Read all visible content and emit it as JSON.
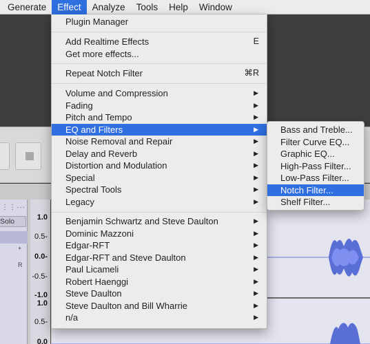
{
  "menubar": {
    "items": [
      "Generate",
      "Effect",
      "Analyze",
      "Tools",
      "Help",
      "Window"
    ],
    "active": "Effect"
  },
  "effect_menu": {
    "plugin_manager": "Plugin Manager",
    "add_realtime": "Add Realtime Effects",
    "add_realtime_shortcut": "E",
    "get_more": "Get more effects...",
    "repeat": "Repeat Notch Filter",
    "repeat_shortcut": "⌘R",
    "categories": [
      "Volume and Compression",
      "Fading",
      "Pitch and Tempo",
      "EQ and Filters",
      "Noise Removal and Repair",
      "Delay and Reverb",
      "Distortion and Modulation",
      "Special",
      "Spectral Tools",
      "Legacy"
    ],
    "highlighted_category": "EQ and Filters",
    "authors": [
      "Benjamin Schwartz and Steve Daulton",
      "Dominic Mazzoni",
      "Edgar-RFT",
      "Edgar-RFT and Steve Daulton",
      "Paul Licameli",
      "Robert Haenggi",
      "Steve Daulton",
      "Steve Daulton and Bill Wharrie",
      "n/a"
    ]
  },
  "eq_submenu": {
    "items": [
      "Bass and Treble...",
      "Filter Curve EQ...",
      "Graphic EQ...",
      "High-Pass Filter...",
      "Low-Pass Filter...",
      "Notch Filter...",
      "Shelf Filter..."
    ],
    "highlighted": "Notch Filter..."
  },
  "track": {
    "solo_label": "Solo",
    "plus_mark": "+",
    "r_mark": "R",
    "ruler_labels": [
      "1.0",
      "0.5-",
      "0.0-",
      "-0.5-",
      "-1.0",
      "1.0",
      "0.5-",
      "0.0"
    ]
  },
  "colors": {
    "menu_highlight": "#2f6fe0",
    "menu_bg": "#ececec",
    "waveform": "#5a6fd6"
  }
}
